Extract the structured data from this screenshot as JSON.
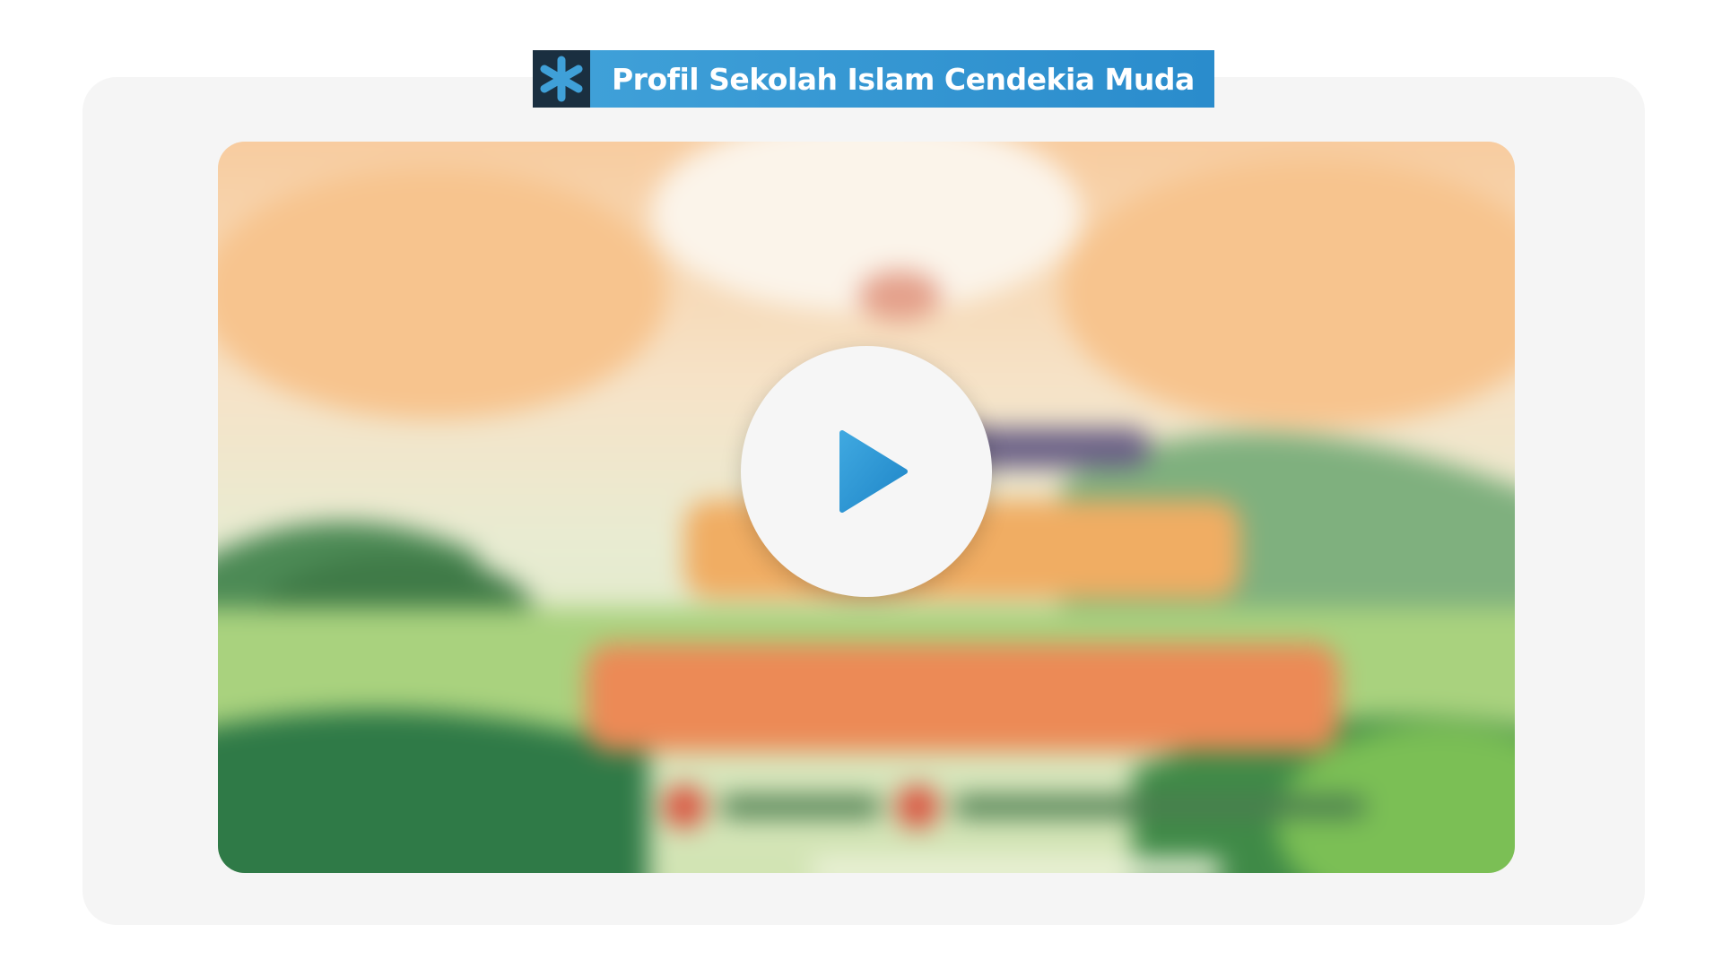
{
  "header": {
    "title": "Profil Sekolah Islam Cendekia Muda",
    "icon": "asterisk-icon"
  },
  "video": {
    "play_icon": "play-icon",
    "colors": {
      "accent": "#2a8ccc",
      "title_bar_dark": "#1a2f40",
      "play_button_bg": "#f6f6f6"
    }
  }
}
